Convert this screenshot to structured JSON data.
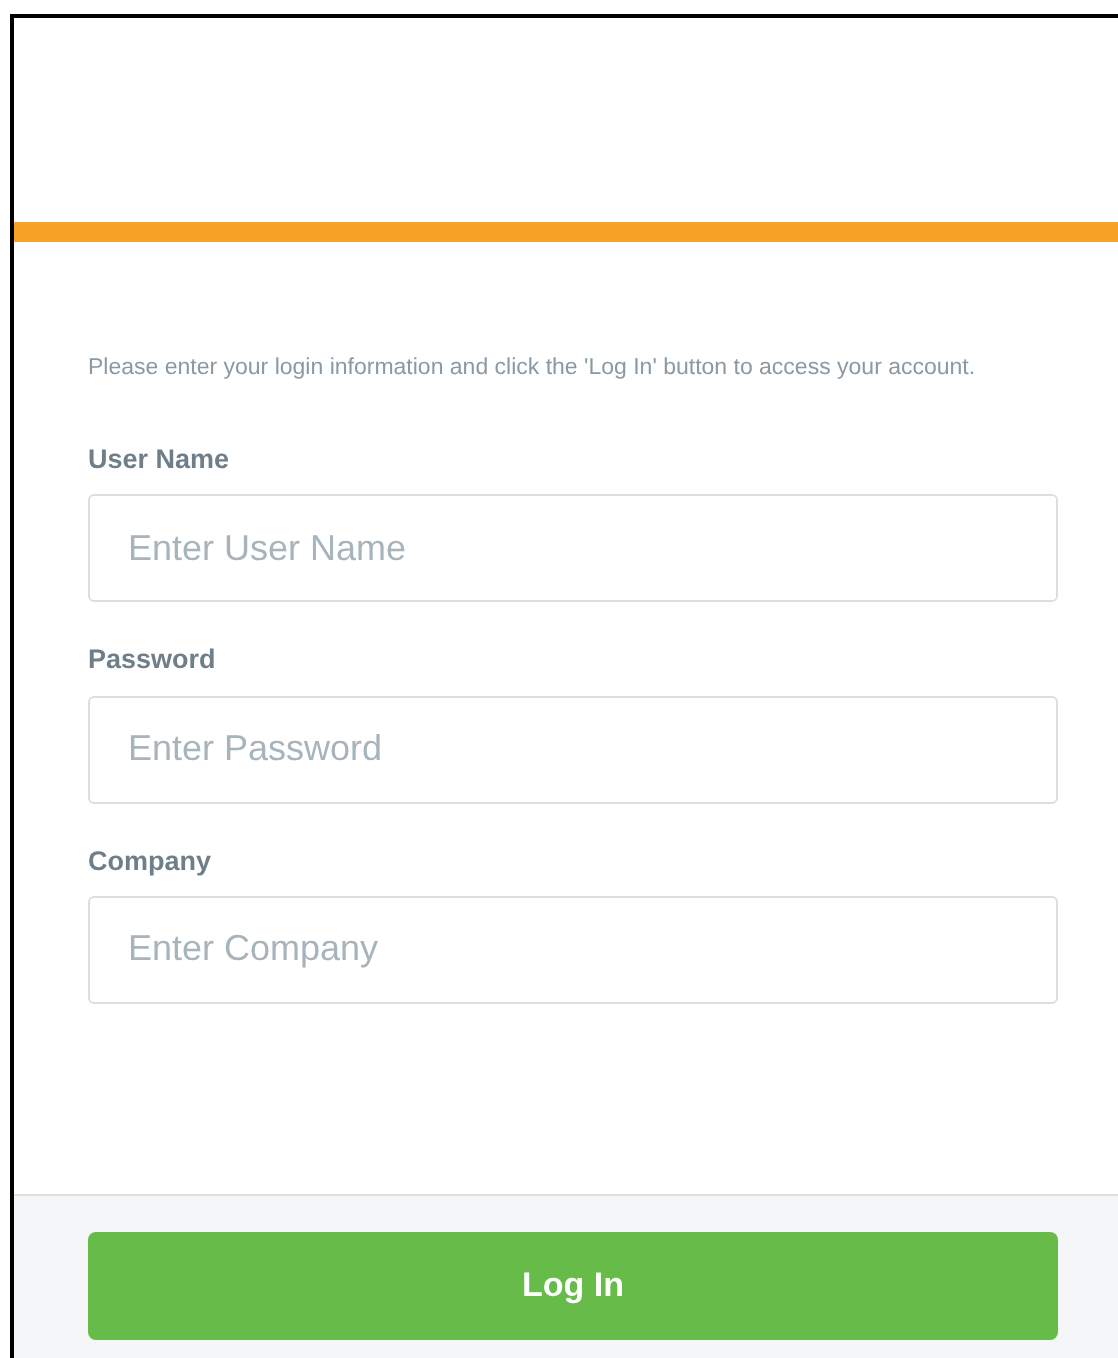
{
  "intro": "Please enter your login information and click the 'Log In' button to access your account.",
  "fields": [
    {
      "label": "User Name",
      "placeholder": "Enter User Name"
    },
    {
      "label": "Password",
      "placeholder": "Enter Password"
    },
    {
      "label": "Company",
      "placeholder": "Enter Company"
    }
  ],
  "button": "Log In"
}
